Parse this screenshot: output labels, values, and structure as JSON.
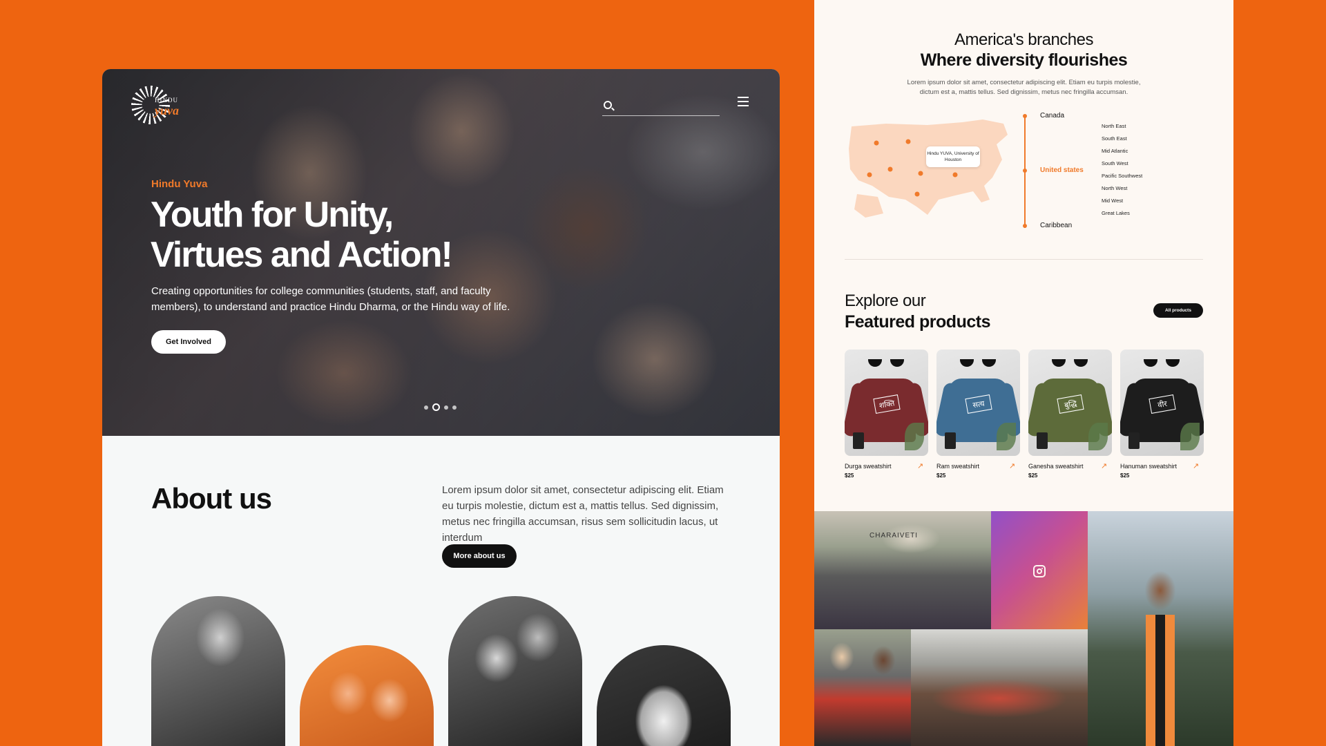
{
  "hero": {
    "logo_top": "HINDU",
    "logo_bottom": "yuva",
    "eyebrow": "Hindu Yuva",
    "title_regular_1": "Youth for ",
    "title_bold_1": "Unity,",
    "title_bold_2": "Virtues and Action!",
    "description": "Creating opportunities for college communities (students, staff, and faculty members), to understand and practice Hindu Dharma, or the Hindu way of life.",
    "cta_label": "Get Involved",
    "carousel": {
      "slides": 4,
      "active_index": 1
    }
  },
  "about": {
    "title": "About us",
    "text": "Lorem ipsum dolor sit amet, consectetur adipiscing elit. Etiam eu turpis molestie, dictum est a, mattis tellus. Sed dignissim, metus nec fringilla accumsan, risus sem sollicitudin lacus, ut interdum",
    "cta_label": "More about us"
  },
  "branches": {
    "title_line1": "America's branches",
    "title_line2": "Where diversity flourishes",
    "description": "Lorem ipsum dolor sit amet, consectetur adipiscing elit. Etiam eu turpis molestie, dictum est a, mattis tellus. Sed dignissim, metus nec fringilla accumsan.",
    "map_callout": "Hindu YUVA, University of Houston",
    "regions": [
      "Canada",
      "United states",
      "Caribbean"
    ],
    "active_region": "United states",
    "sub_regions": [
      "North East",
      "South East",
      "Mid Atlantic",
      "South West",
      "Pacific Southwest",
      "North West",
      "Mid West",
      "Great Lakes"
    ]
  },
  "products": {
    "title_line1": "Explore our",
    "title_line2": "Featured products",
    "all_label": "All products",
    "items": [
      {
        "name": "Durga sweatshirt",
        "price": "$25",
        "label": "शक्ति",
        "color": "#7a2b2e"
      },
      {
        "name": "Ram sweatshirt",
        "price": "$25",
        "label": "सत्य",
        "color": "#3f6e94"
      },
      {
        "name": "Ganesha sweatshirt",
        "price": "$25",
        "label": "बुद्धि",
        "color": "#5d6b3a"
      },
      {
        "name": "Hanuman sweatshirt",
        "price": "$25",
        "label": "वीर",
        "color": "#1d1d1d"
      }
    ]
  },
  "gallery": {
    "banner_text": "CHARAIVETI"
  },
  "colors": {
    "brand_orange": "#ee6410",
    "accent_orange": "#f07a2a"
  }
}
